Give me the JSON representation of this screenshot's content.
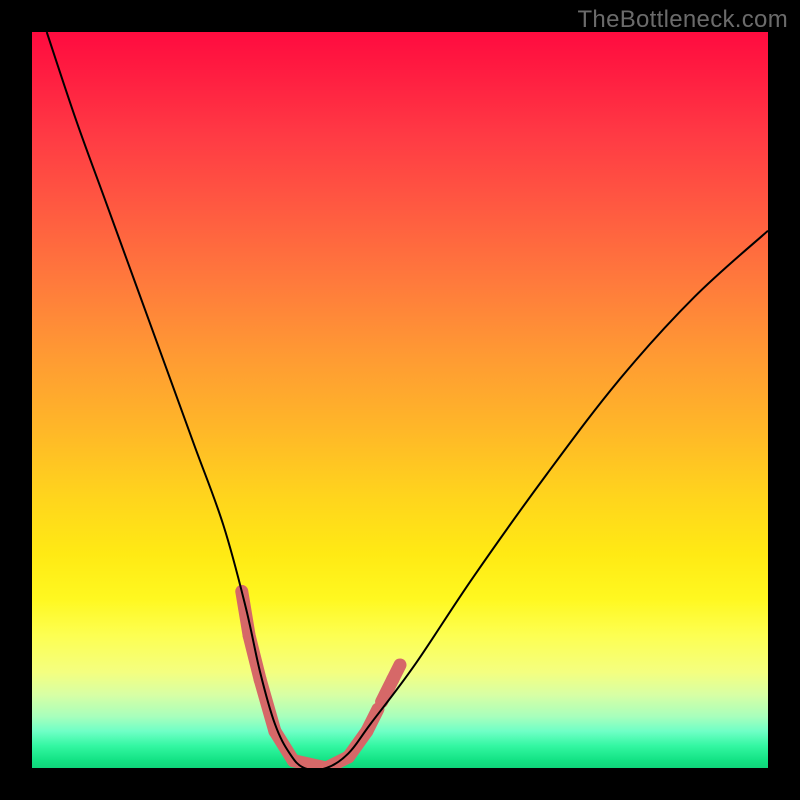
{
  "watermark": "TheBottleneck.com",
  "chart_data": {
    "type": "line",
    "title": "",
    "xlabel": "",
    "ylabel": "",
    "xlim": [
      0,
      100
    ],
    "ylim": [
      0,
      100
    ],
    "grid": false,
    "series": [
      {
        "name": "bottleneck-curve",
        "x": [
          2,
          6,
          10,
          14,
          18,
          22,
          26,
          29,
          31,
          33,
          35,
          37,
          40,
          43,
          46,
          52,
          60,
          70,
          80,
          90,
          100
        ],
        "values": [
          100,
          88,
          77,
          66,
          55,
          44,
          33,
          22,
          13,
          6,
          2,
          0,
          0,
          2,
          6,
          14,
          26,
          40,
          53,
          64,
          73
        ],
        "color": "#000000",
        "stroke_width": 2
      }
    ],
    "markers": [
      {
        "seg_x": [
          28.5,
          29.5
        ],
        "seg_y": [
          24.0,
          18.0
        ],
        "color": "#d66868",
        "width": 13
      },
      {
        "seg_x": [
          29.5,
          31.0
        ],
        "seg_y": [
          18.0,
          12.0
        ],
        "color": "#d66868",
        "width": 13
      },
      {
        "seg_x": [
          31.0,
          33.0
        ],
        "seg_y": [
          12.0,
          5.0
        ],
        "color": "#d66868",
        "width": 13
      },
      {
        "seg_x": [
          33.0,
          35.5
        ],
        "seg_y": [
          5.0,
          1.0
        ],
        "color": "#d66868",
        "width": 13
      },
      {
        "seg_x": [
          35.5,
          40.0
        ],
        "seg_y": [
          1.0,
          0.0
        ],
        "color": "#d66868",
        "width": 13
      },
      {
        "seg_x": [
          40.0,
          43.0
        ],
        "seg_y": [
          0.0,
          1.5
        ],
        "color": "#d66868",
        "width": 13
      },
      {
        "seg_x": [
          43.0,
          45.5
        ],
        "seg_y": [
          1.5,
          5.0
        ],
        "color": "#d66868",
        "width": 13
      },
      {
        "seg_x": [
          45.5,
          47.0
        ],
        "seg_y": [
          5.0,
          8.0
        ],
        "color": "#d66868",
        "width": 13
      },
      {
        "seg_x": [
          47.5,
          49.0
        ],
        "seg_y": [
          9.0,
          12.0
        ],
        "color": "#d66868",
        "width": 13
      },
      {
        "seg_x": [
          49.0,
          50.0
        ],
        "seg_y": [
          12.0,
          14.0
        ],
        "color": "#d66868",
        "width": 13
      }
    ],
    "background_gradient": {
      "top": "#ff0b3f",
      "mid": "#ffe018",
      "bottom": "#0fd47a"
    }
  }
}
